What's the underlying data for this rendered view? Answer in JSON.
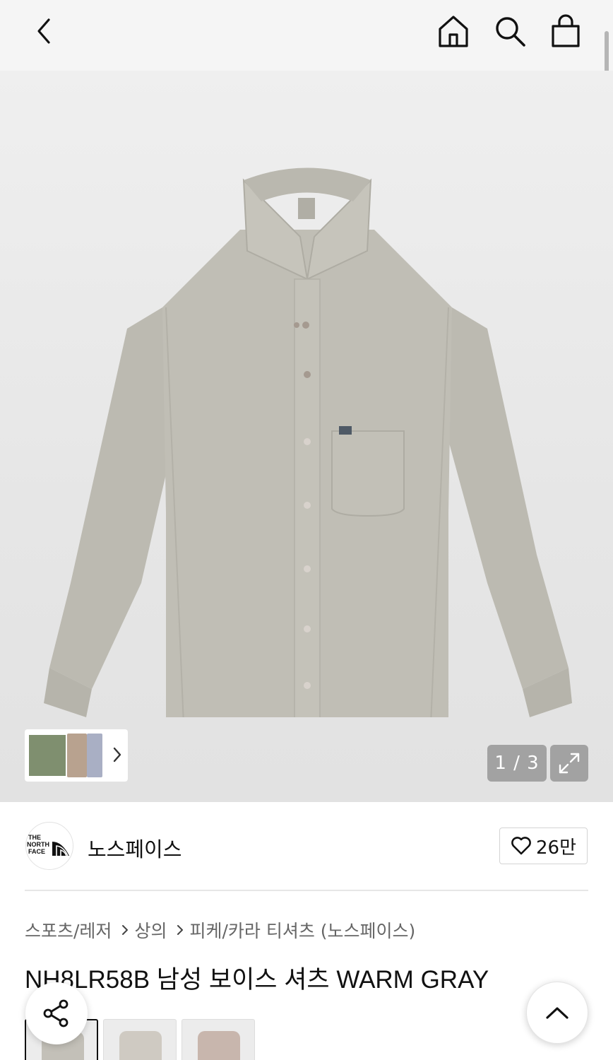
{
  "header": {
    "back_icon": "chevron-left-icon",
    "home_icon": "home-icon",
    "search_icon": "search-icon",
    "cart_icon": "shopping-bag-icon"
  },
  "gallery": {
    "pager": "1 / 3",
    "expand_icon": "expand-arrows-icon",
    "thumbnail_arrow_icon": "chevron-right-icon",
    "image_count": 3,
    "current_index": 1,
    "colors": {
      "shirt": "#bdbbb2",
      "background": "#e8e8e8"
    }
  },
  "brand": {
    "logo_text": "THE NORTH FACE",
    "name": "노스페이스",
    "like_icon": "heart-outline-icon",
    "like_count": "26만"
  },
  "breadcrumb": {
    "items": [
      "스포츠/레저",
      "상의",
      "피케/카라 티셔츠 (노스페이스)"
    ],
    "separator_icon": "chevron-right-icon"
  },
  "product": {
    "title": "NH8LR58B 남성 보이스 셔츠 WARM GRAY"
  },
  "color_options": {
    "swatches": [
      "#c3c0b8",
      "#cfcac2",
      "#c8b6ad"
    ],
    "selected_index": 0
  },
  "floating": {
    "share_icon": "share-icon",
    "scroll_top_icon": "chevron-up-icon"
  }
}
